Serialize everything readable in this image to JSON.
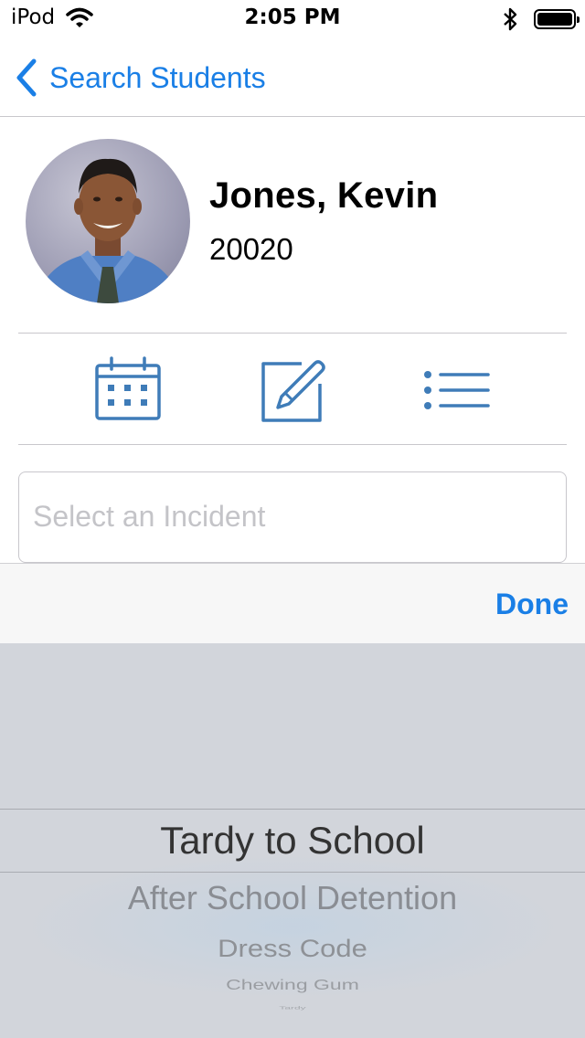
{
  "status_bar": {
    "carrier": "iPod",
    "time": "2:05 PM",
    "wifi_icon": "wifi-icon",
    "bluetooth_icon": "bluetooth-icon",
    "battery_icon": "battery-icon",
    "battery_level": 1.0
  },
  "nav": {
    "back_label": "Search Students",
    "back_icon": "chevron-left-icon"
  },
  "student": {
    "name": "Jones, Kevin",
    "id": "20020",
    "avatar": "student-photo"
  },
  "actions": [
    {
      "icon": "calendar-icon"
    },
    {
      "icon": "compose-icon"
    },
    {
      "icon": "list-icon"
    }
  ],
  "incident_field": {
    "placeholder": "Select an Incident",
    "value": ""
  },
  "toolbar": {
    "done_label": "Done"
  },
  "picker": {
    "selected": "Tardy to School",
    "options": [
      "Tardy to School",
      "After School Detention",
      "Dress Code",
      "Chewing Gum",
      "Tardy"
    ]
  },
  "colors": {
    "accent": "#1a7fe6",
    "icon": "#3f7cb8",
    "separator": "#c8c7cc",
    "picker_background": "#d2d5db"
  }
}
